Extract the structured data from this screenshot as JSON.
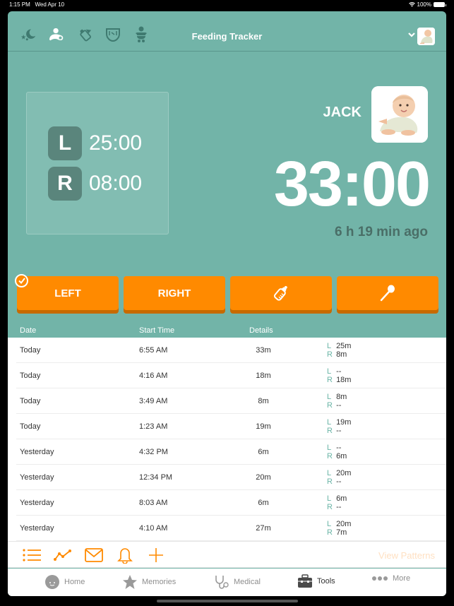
{
  "status_bar": {
    "time": "1:15 PM",
    "date": "Wed Apr 10",
    "battery": "100%"
  },
  "header": {
    "title": "Feeding Tracker",
    "icons": [
      "sleep-icon",
      "breastfeeding-icon",
      "bottle-icon",
      "diaper-icon",
      "baby-icon"
    ],
    "active_icon": "breastfeeding-icon"
  },
  "side_summary": {
    "left_label": "L",
    "left_time": "25:00",
    "right_label": "R",
    "right_time": "08:00"
  },
  "baby": {
    "name": "JACK"
  },
  "timer": {
    "total": "33:00",
    "ago": "6 h 19 min ago"
  },
  "actions": [
    {
      "label": "LEFT",
      "checked": true
    },
    {
      "label": "RIGHT",
      "checked": false
    },
    {
      "label": "",
      "icon": "bottle-icon"
    },
    {
      "label": "",
      "icon": "spoon-icon"
    }
  ],
  "table": {
    "headers": {
      "date": "Date",
      "start": "Start Time",
      "details": "Details"
    },
    "rows": [
      {
        "date": "Today",
        "start": "6:55 AM",
        "duration": "33m",
        "left": "25m",
        "right": "8m"
      },
      {
        "date": "Today",
        "start": "4:16 AM",
        "duration": "18m",
        "left": "--",
        "right": "18m"
      },
      {
        "date": "Today",
        "start": "3:49 AM",
        "duration": "8m",
        "left": "8m",
        "right": "--"
      },
      {
        "date": "Today",
        "start": "1:23 AM",
        "duration": "19m",
        "left": "19m",
        "right": "--"
      },
      {
        "date": "Yesterday",
        "start": "4:32 PM",
        "duration": "6m",
        "left": "--",
        "right": "6m"
      },
      {
        "date": "Yesterday",
        "start": "12:34 PM",
        "duration": "20m",
        "left": "20m",
        "right": "--"
      },
      {
        "date": "Yesterday",
        "start": "8:03 AM",
        "duration": "6m",
        "left": "6m",
        "right": "--"
      },
      {
        "date": "Yesterday",
        "start": "4:10 AM",
        "duration": "27m",
        "left": "20m",
        "right": "7m"
      }
    ],
    "side_labels": {
      "left": "L",
      "right": "R"
    }
  },
  "toolbar": {
    "icons": [
      "list-icon",
      "chart-icon",
      "mail-icon",
      "bell-icon",
      "plus-icon"
    ],
    "view_patterns": "View Patterns"
  },
  "tabbar": {
    "items": [
      {
        "label": "Home",
        "icon": "baby-face-icon"
      },
      {
        "label": "Memories",
        "icon": "star-icon"
      },
      {
        "label": "Medical",
        "icon": "stethoscope-icon"
      },
      {
        "label": "Tools",
        "icon": "toolbox-icon",
        "active": true
      },
      {
        "label": "More",
        "icon": "more-icon"
      }
    ]
  },
  "colors": {
    "teal": "#72b4a8",
    "orange": "#ff8a00",
    "dark_teal": "#5a857c"
  }
}
